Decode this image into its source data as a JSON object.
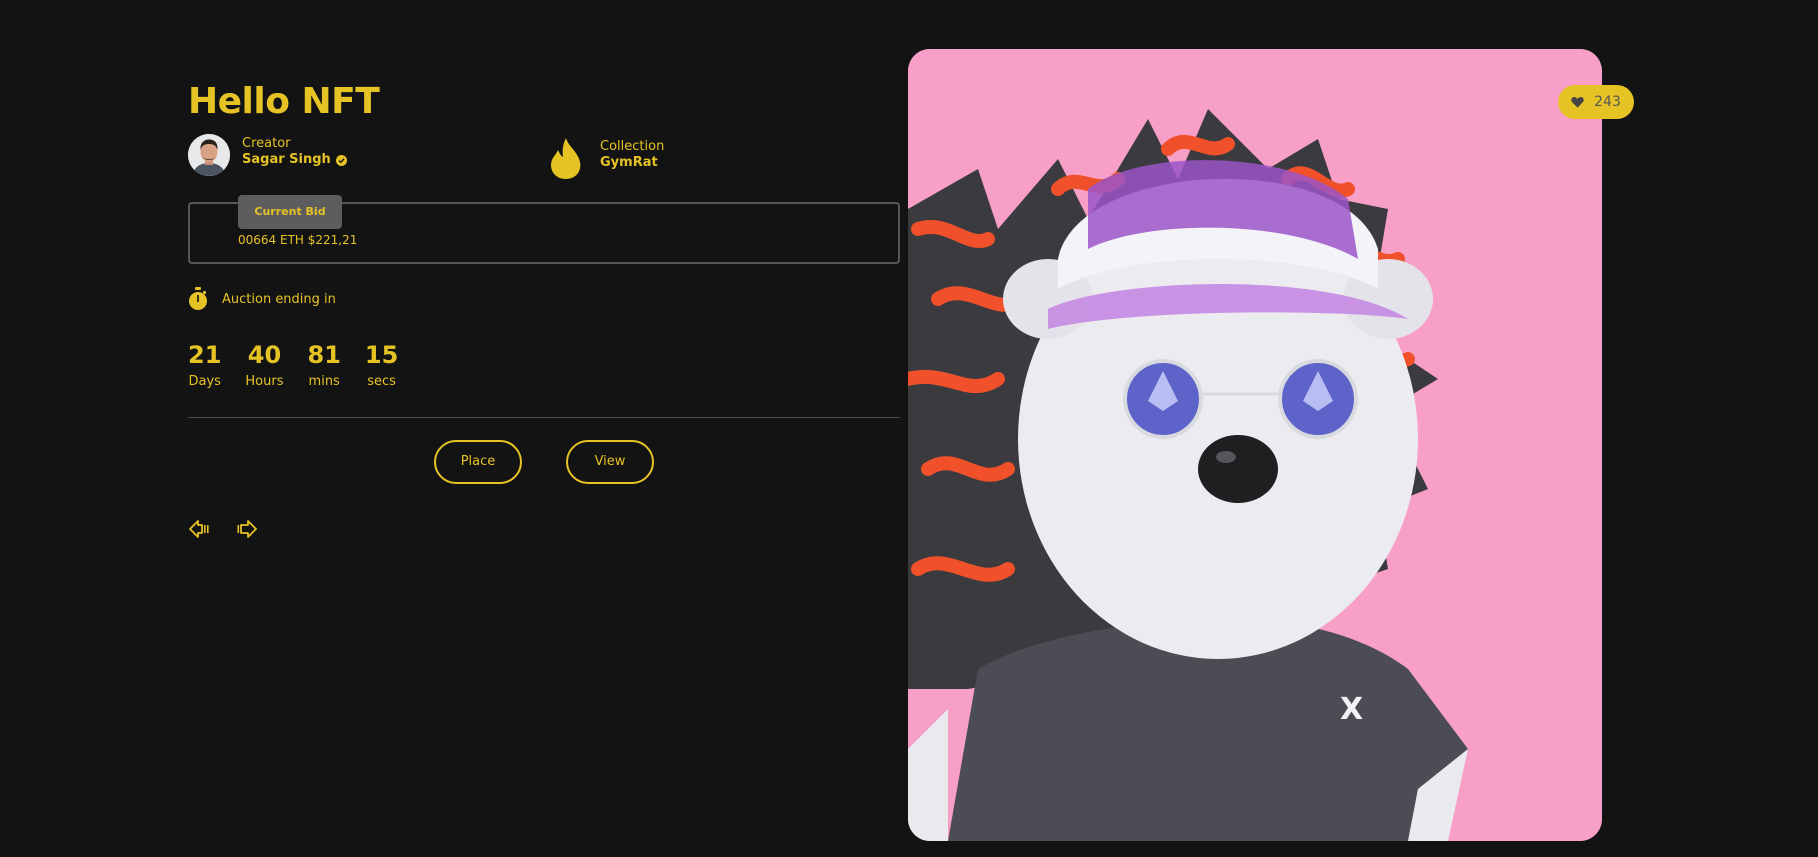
{
  "hero": {
    "title": "Hello NFT"
  },
  "creator": {
    "label": "Creator",
    "name": "Sagar Singh",
    "verified_icon": "verified-check-icon"
  },
  "collection": {
    "label": "Collection",
    "name": "GymRat",
    "icon": "flame-icon"
  },
  "bid": {
    "tab_label": "Current Bid",
    "value": "00664 ETH $221,21"
  },
  "auction": {
    "label": "Auction ending in",
    "icon": "stopwatch-icon",
    "countdown": [
      {
        "value": "21",
        "label": "Days"
      },
      {
        "value": "40",
        "label": "Hours"
      },
      {
        "value": "81",
        "label": "mins"
      },
      {
        "value": "15",
        "label": "secs"
      }
    ]
  },
  "actions": {
    "place_label": "Place",
    "view_label": "View"
  },
  "navigation": {
    "prev_icon": "arrow-left-icon",
    "next_icon": "arrow-right-icon"
  },
  "likes": {
    "count": "243",
    "icon": "heart-icon"
  },
  "colors": {
    "background": "#131313",
    "accent": "#e6c325",
    "art_background": "#f89fc8"
  }
}
